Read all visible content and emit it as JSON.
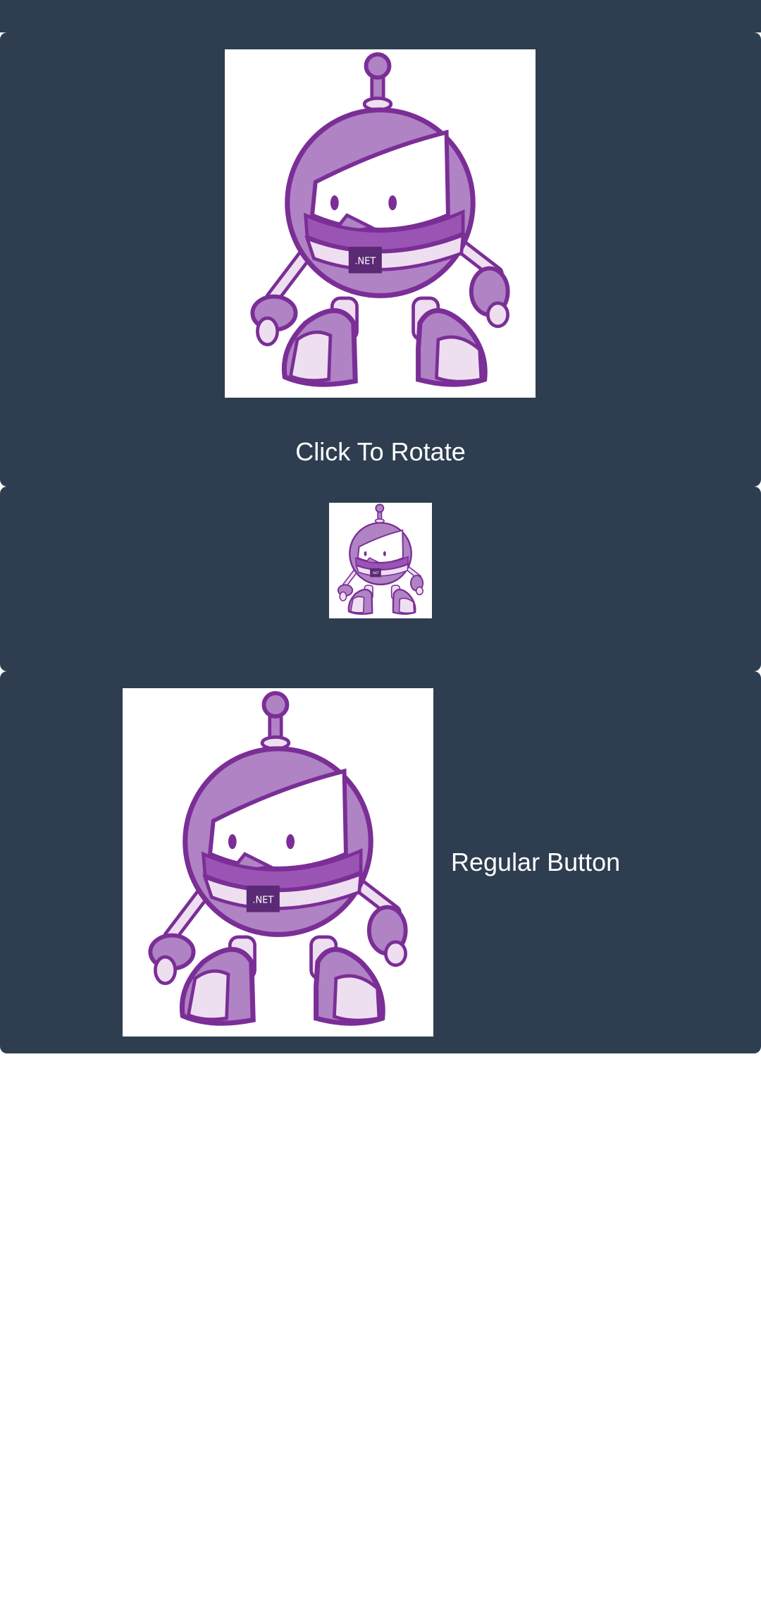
{
  "buttons": [
    {
      "label": "Click To Rotate",
      "image": "dotnet-bot-image"
    },
    {
      "label": "",
      "image": "dotnet-bot-image"
    },
    {
      "label": "Regular Button",
      "image": "dotnet-bot-image"
    }
  ],
  "colors": {
    "button_background": "#2e3e50",
    "label_text": "#ffffff",
    "robot_purple": "#b083c4",
    "robot_dark": "#7a2e96",
    "robot_light": "#eedff0",
    "badge": "#5b2a74"
  },
  "robot": {
    "badge_text": ".NET"
  }
}
